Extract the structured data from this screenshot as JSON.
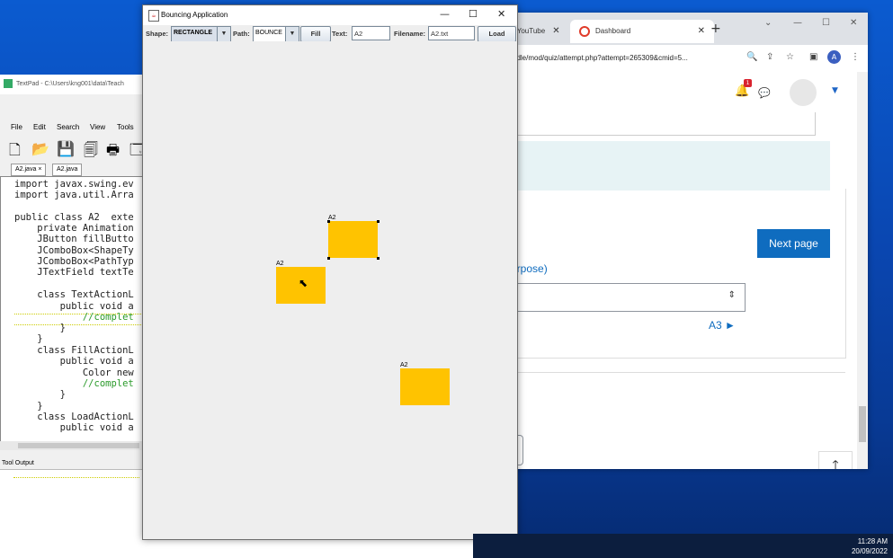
{
  "swing": {
    "title": "Bouncing Application",
    "toolbar": {
      "shape_label": "Shape:",
      "shape_value": "RECTANGLE",
      "path_label": "Path:",
      "path_value": "BOUNCE",
      "fill_button": "Fill",
      "text_label": "Text:",
      "text_value": "A2",
      "filename_label": "Filename:",
      "filename_value": "A2.txt",
      "load_button": "Load"
    },
    "shapes": [
      {
        "label": "A2",
        "selected": true
      },
      {
        "label": "A2",
        "selected": false
      },
      {
        "label": "A2",
        "selected": false
      }
    ],
    "controls": {
      "minimize": "—",
      "maximize": "☐",
      "close": "✕"
    }
  },
  "textpad": {
    "title": "TextPad - C:\\Users\\kng001\\data\\Teach",
    "menu": [
      "File",
      "Edit",
      "Search",
      "View",
      "Tools"
    ],
    "tabs": [
      "A2.java",
      "A2.java"
    ],
    "tab_close": "×",
    "code": [
      "import javax.swing.ev",
      "import java.util.Arra",
      "",
      "public class A2  exte",
      "    private Animation",
      "    JButton fillButto",
      "    JComboBox<ShapeTy",
      "    JComboBox<PathTyp",
      "    JTextField textTe",
      "",
      "    class TextActionL",
      "        public void a",
      "            //complet",
      "        }",
      "    }",
      "    class FillActionL",
      "        public void a",
      "            Color new",
      "            //complet",
      "        }",
      "    }",
      "    class LoadActionL",
      "        public void a"
    ],
    "tool_output_label": "Tool Output"
  },
  "browser": {
    "tabs": [
      "- YouTube",
      "Dashboard"
    ],
    "url": "odle/mod/quiz/attempt.php?attempt=265309&cmid=5...",
    "profile_initial": "A",
    "notification_count": "1",
    "next_button": "Next page",
    "purpose_text": "urpose)",
    "select_arrow": "⇕",
    "a3_link": "A3 ►",
    "back_to_top": "🡑",
    "accent": "#0f6cbf"
  },
  "clock": {
    "time": "11:28 AM",
    "date": "20/09/2022"
  },
  "colors": {
    "shape_fill": "#ffc300"
  }
}
